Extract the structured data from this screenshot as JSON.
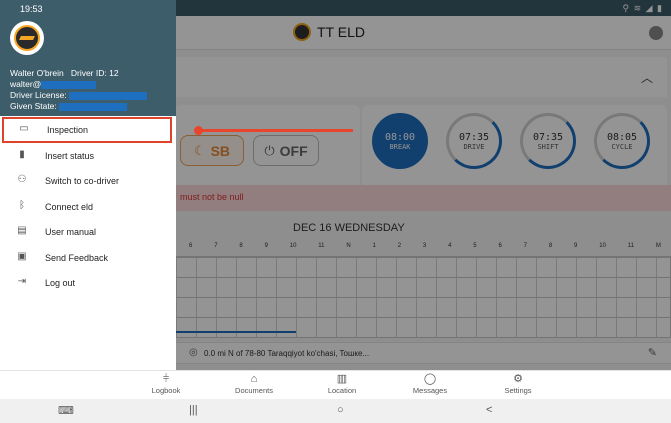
{
  "status_bar": {
    "time": "19:53",
    "right_icons": "⚲ ≋ ◢ ▮"
  },
  "header": {
    "title": "TT ELD"
  },
  "duty_status": {
    "sb_label": "SB",
    "off_label": "OFF"
  },
  "timers": [
    {
      "value": "08:00",
      "label": "BREAK"
    },
    {
      "value": "07:35",
      "label": "DRIVE"
    },
    {
      "value": "07:35",
      "label": "SHIFT"
    },
    {
      "value": "08:05",
      "label": "CYCLE"
    }
  ],
  "error_text": "must not be null",
  "log": {
    "date_title": "DEC 16 WEDNESDAY",
    "hours": [
      "6",
      "7",
      "8",
      "9",
      "10",
      "11",
      "N",
      "1",
      "2",
      "3",
      "4",
      "5",
      "6",
      "7",
      "8",
      "9",
      "10",
      "11",
      "M"
    ]
  },
  "location": {
    "text": "0.0 mi N of 78-80 Taraqqiyot ko'chasi, Toшке..."
  },
  "drawer": {
    "driver_name": "Walter O'brein",
    "driver_id": "Driver ID: 12",
    "email_prefix": "walter@",
    "license_label": "Driver License:",
    "state_label": "Given State:",
    "items": [
      {
        "icon": "calendar-icon",
        "label": "Inspection"
      },
      {
        "icon": "chart-icon",
        "label": "Insert status"
      },
      {
        "icon": "users-icon",
        "label": "Switch to co-driver"
      },
      {
        "icon": "bluetooth-icon",
        "label": "Connect eld"
      },
      {
        "icon": "book-icon",
        "label": "User manual"
      },
      {
        "icon": "feedback-icon",
        "label": "Send Feedback"
      },
      {
        "icon": "logout-icon",
        "label": "Log out"
      }
    ]
  },
  "tabs": [
    {
      "icon": "logbook-icon",
      "label": "Logbook"
    },
    {
      "icon": "documents-icon",
      "label": "Documents"
    },
    {
      "icon": "map-icon",
      "label": "Location"
    },
    {
      "icon": "message-icon",
      "label": "Messages"
    },
    {
      "icon": "settings-icon",
      "label": "Settings"
    }
  ],
  "colors": {
    "accent": "#1e6fc0",
    "drawer_header": "#3d5d6b",
    "highlight": "#e0432b",
    "sb_orange": "#e8893a"
  }
}
